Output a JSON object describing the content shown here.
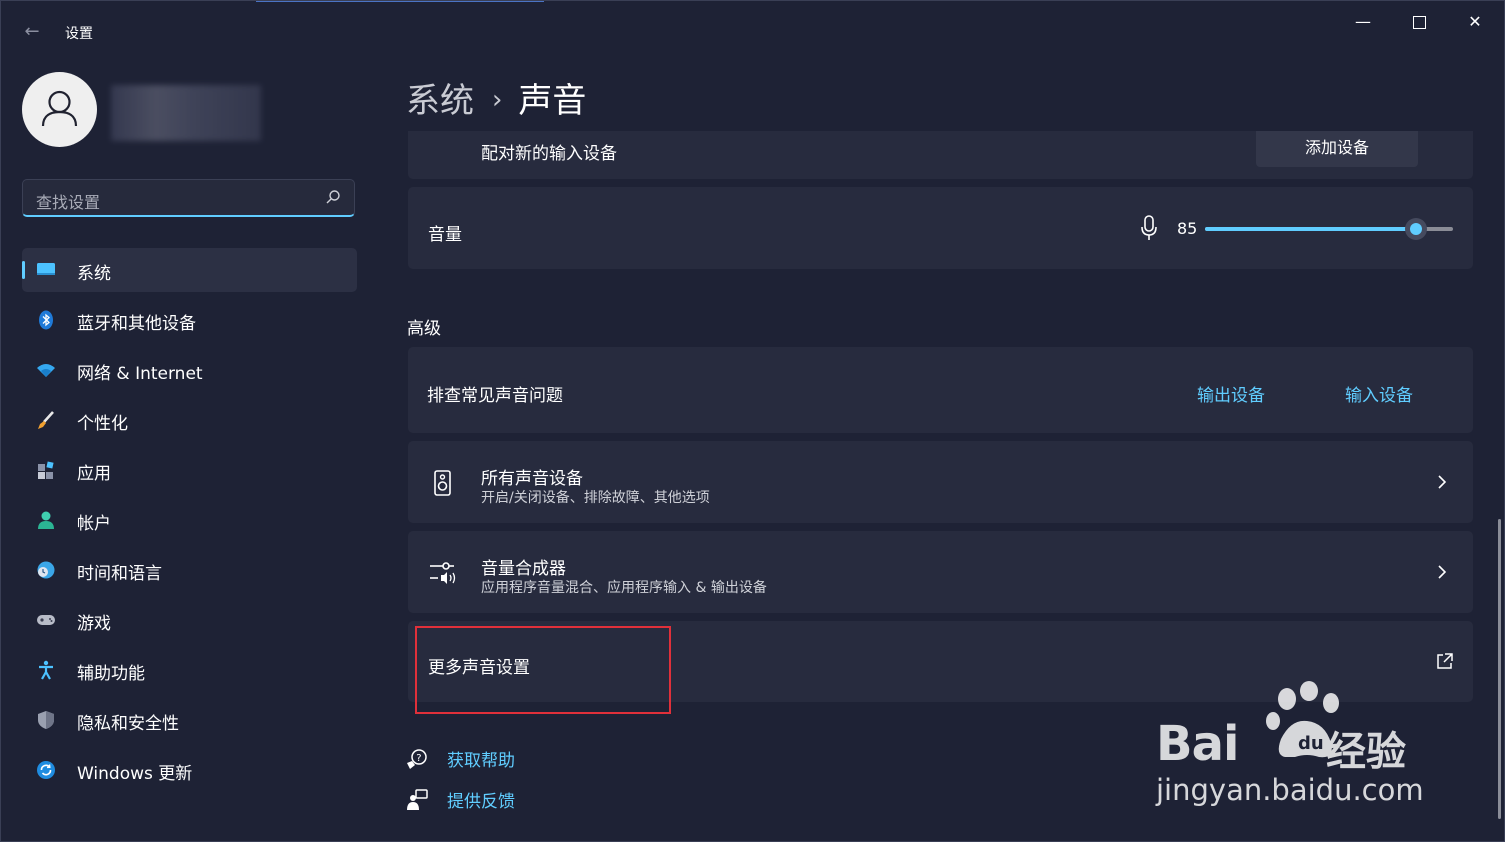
{
  "window": {
    "title": "设置"
  },
  "search": {
    "placeholder": "查找设置"
  },
  "sidebar": {
    "items": [
      {
        "label": "系统",
        "icon": "monitor-icon",
        "active": true
      },
      {
        "label": "蓝牙和其他设备",
        "icon": "bluetooth-icon"
      },
      {
        "label": "网络 & Internet",
        "icon": "wifi-icon"
      },
      {
        "label": "个性化",
        "icon": "brush-icon"
      },
      {
        "label": "应用",
        "icon": "apps-icon"
      },
      {
        "label": "帐户",
        "icon": "person-icon"
      },
      {
        "label": "时间和语言",
        "icon": "globe-clock-icon"
      },
      {
        "label": "游戏",
        "icon": "gamepad-icon"
      },
      {
        "label": "辅助功能",
        "icon": "accessibility-icon"
      },
      {
        "label": "隐私和安全性",
        "icon": "shield-icon"
      },
      {
        "label": "Windows 更新",
        "icon": "update-icon"
      }
    ]
  },
  "header": {
    "parent": "系统",
    "current": "声音"
  },
  "pair_input": {
    "label": "配对新的输入设备",
    "button": "添加设备"
  },
  "volume": {
    "label": "音量",
    "value": "85",
    "level": 0.85
  },
  "advanced": {
    "title": "高级",
    "troubleshoot": {
      "label": "排查常见声音问题",
      "output_link": "输出设备",
      "input_link": "输入设备"
    },
    "all_devices": {
      "label": "所有声音设备",
      "description": "开启/关闭设备、排除故障、其他选项"
    },
    "mixer": {
      "label": "音量合成器",
      "description": "应用程序音量混合、应用程序输入 & 输出设备"
    },
    "more_settings": {
      "label": "更多声音设置"
    }
  },
  "help": {
    "get_help": "获取帮助",
    "feedback": "提供反馈"
  },
  "watermark": {
    "brand": "Baidu",
    "brand_cn": "经验",
    "url": "jingyan.baidu.com"
  },
  "colors": {
    "accent": "#60cdff",
    "background": "#1e2235",
    "card": "#272b3e",
    "highlight": "#e0303a"
  }
}
